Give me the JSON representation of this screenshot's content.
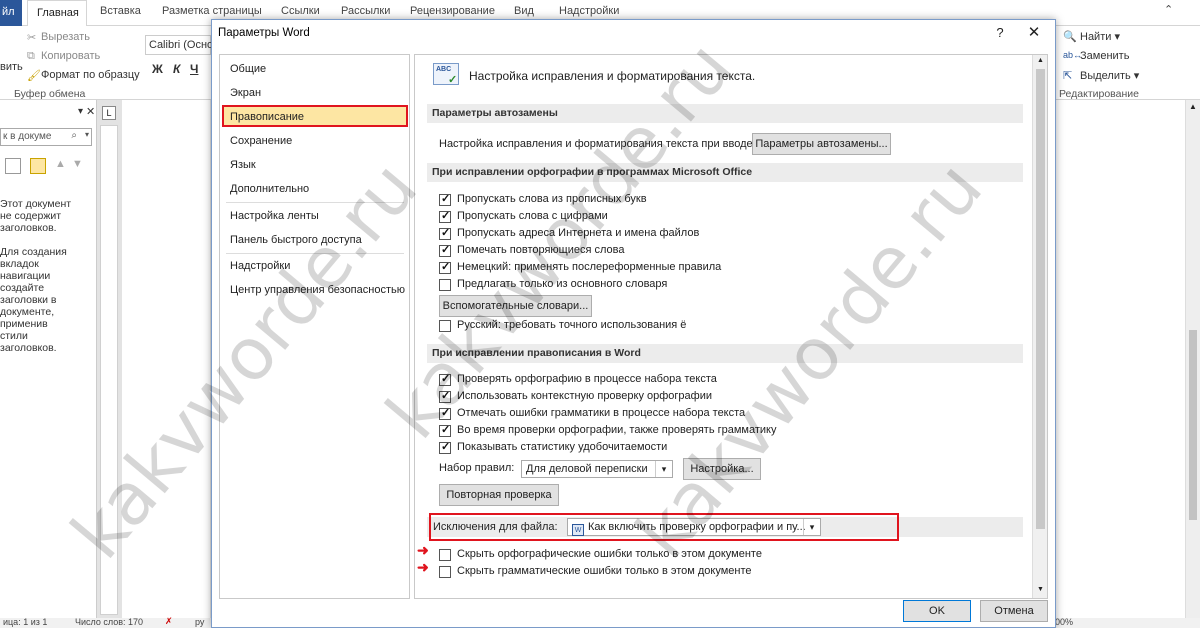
{
  "ribbon": {
    "file_tab": "йл",
    "tabs": [
      "Главная",
      "Вставка",
      "Разметка страницы",
      "Ссылки",
      "Рассылки",
      "Рецензирование",
      "Вид",
      "Надстройки"
    ],
    "clipboard": {
      "paste": "вить",
      "cut": "Вырезать",
      "copy": "Копировать",
      "format": "Формат по образцу",
      "group": "Буфер обмена"
    },
    "font_name": "Calibri (Осно",
    "editing": {
      "find": "Найти",
      "replace": "Заменить",
      "select": "Выделить",
      "group": "Редактирование"
    }
  },
  "nav_pane": {
    "search_placeholder": "к в докуме",
    "text1": [
      "Этот документ",
      "не содержит",
      "заголовков."
    ],
    "text2": [
      "Для создания",
      "вкладок",
      "навигации",
      "создайте",
      "заголовки в",
      "документе,",
      "применив",
      "стили",
      "заголовков."
    ]
  },
  "status": {
    "page": "ица: 1 из 1",
    "words": "Число слов: 170",
    "lang": "ру",
    "zoom": "00%"
  },
  "dialog": {
    "title": "Параметры Word",
    "help": "?",
    "close": "✕",
    "nav": {
      "items": [
        "Общие",
        "Экран",
        "Правописание",
        "Сохранение",
        "Язык",
        "Дополнительно",
        "Настройка ленты",
        "Панель быстрого доступа",
        "Надстройки",
        "Центр управления безопасностью"
      ],
      "selected_index": 2
    },
    "content": {
      "intro": "Настройка исправления и форматирования текста.",
      "autocorrect_header": "Параметры автозамены",
      "autocorrect_label": "Настройка исправления и форматирования текста при вводе:",
      "autocorrect_button": "Параметры автозамены...",
      "office_header": "При исправлении орфографии в программах Microsoft Office",
      "office_options": [
        {
          "label": "Пропускать слова из прописных букв",
          "checked": true
        },
        {
          "label": "Пропускать слова с цифрами",
          "checked": true
        },
        {
          "label": "Пропускать адреса Интернета и имена файлов",
          "checked": true
        },
        {
          "label": "Помечать повторяющиеся слова",
          "checked": true
        },
        {
          "label": "Немецкий: применять послереформенные правила",
          "checked": true
        },
        {
          "label": "Предлагать только из основного словаря",
          "checked": false
        }
      ],
      "custom_dict_button": "Вспомогательные словари...",
      "russian_option": {
        "label": "Русский: требовать точного использования ё",
        "checked": false
      },
      "word_header": "При исправлении правописания в Word",
      "word_options": [
        {
          "label": "Проверять орфографию в процессе набора текста",
          "checked": true
        },
        {
          "label": "Использовать контекстную проверку орфографии",
          "checked": true
        },
        {
          "label": "Отмечать ошибки грамматики в процессе набора текста",
          "checked": true
        },
        {
          "label": "Во время проверки орфографии, также проверять грамматику",
          "checked": true
        },
        {
          "label": "Показывать статистику удобочитаемости",
          "checked": true
        }
      ],
      "ruleset_label": "Набор правил:",
      "ruleset_value": "Для деловой переписки",
      "settings_button": "Настройка...",
      "recheck_button": "Повторная проверка",
      "exceptions_label": "Исключения для файла:",
      "exceptions_value": "Как включить проверку орфографии и пу...",
      "exception_options": [
        {
          "label": "Скрыть орфографические ошибки только в этом документе",
          "checked": false
        },
        {
          "label": "Скрыть грамматические ошибки только в этом документе",
          "checked": false
        }
      ]
    },
    "ok": "OK",
    "cancel": "Отмена"
  },
  "watermark": "kakvworde.ru",
  "colors": {
    "highlight": "#e0141e",
    "selected_bg": "#fde6a3",
    "file_tab": "#2b579a"
  }
}
